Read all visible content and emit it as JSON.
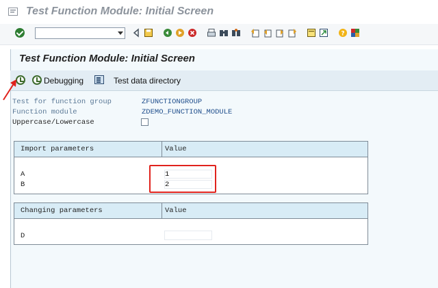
{
  "window": {
    "title": "Test Function Module: Initial Screen"
  },
  "command_field": {
    "value": ""
  },
  "screen": {
    "title": "Test Function Module: Initial Screen"
  },
  "app_toolbar": {
    "debugging_label": "Debugging",
    "test_data_directory_label": "Test data directory"
  },
  "fields": {
    "function_group": {
      "label": "Test for function group",
      "value": "ZFUNCTIONGROUP"
    },
    "function_module": {
      "label": "Function module",
      "value": "ZDEMO_FUNCTION_MODULE"
    },
    "uppercase": {
      "label": "Uppercase/Lowercase",
      "checked": false
    }
  },
  "import_table": {
    "col1": "Import parameters",
    "col2": "Value",
    "rows": [
      {
        "name": "A",
        "value": "1"
      },
      {
        "name": "B",
        "value": "2"
      }
    ]
  },
  "changing_table": {
    "col1": "Changing parameters",
    "col2": "Value",
    "rows": [
      {
        "name": "D",
        "value": ""
      }
    ]
  },
  "colors": {
    "annotation_red": "#e0221c",
    "header_blue": "#d8ecf6",
    "panel_bg": "#f3f9fc"
  },
  "icons": [
    "back-icon",
    "save-icon",
    "back-nav-icon",
    "exit-icon",
    "cancel-icon",
    "print-icon",
    "find-icon",
    "find-next-icon",
    "first-page-icon",
    "previous-page-icon",
    "next-page-icon",
    "last-page-icon",
    "create-session-icon",
    "shortcut-icon",
    "help-icon",
    "customize-layout-icon",
    "execute-icon",
    "debugging-icon",
    "test-data-directory-icon"
  ]
}
